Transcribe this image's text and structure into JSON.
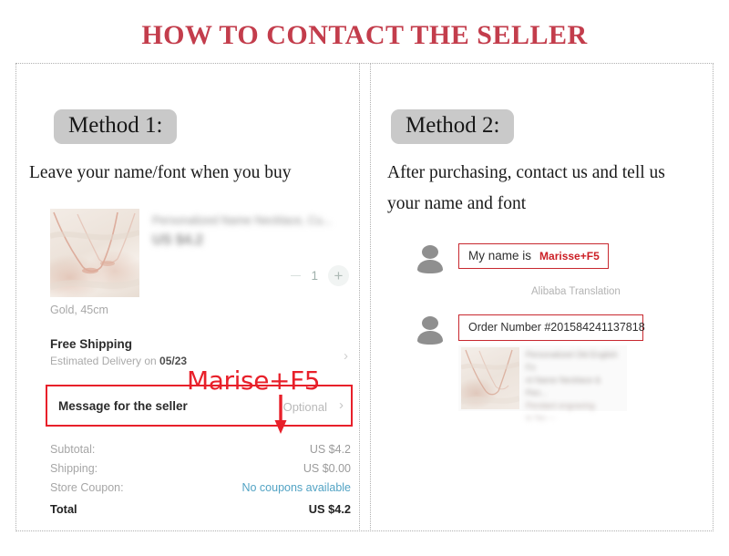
{
  "header": {
    "title": "HOW TO CONTACT THE SELLER",
    "title_color": "#c33d4c"
  },
  "accent": {
    "annotation_red": "#e8202a",
    "bubble_red": "#c8282f",
    "link_blue": "#52a3c4",
    "badge_grey": "#c9c9c9"
  },
  "methods": [
    {
      "badge": "Method 1:",
      "description": "Leave your name/font when you buy"
    },
    {
      "badge": "Method 2:",
      "description": "After purchasing, contact us and tell us your name and font"
    }
  ],
  "checkout": {
    "product": {
      "title_blurred": "Personalized Name Necklace, Cu...",
      "price_blurred": "US $4.2",
      "variant": "Gold, 45cm",
      "image_name": "necklace-product-photo"
    },
    "quantity": {
      "minus_label": "−",
      "value": "1",
      "plus_label": "+"
    },
    "shipping": {
      "title": "Free Shipping",
      "sub_prefix": "Estimated Delivery on ",
      "sub_date": "05/23",
      "chevron": "›"
    },
    "message_row": {
      "label": "Message for the seller",
      "value": "Optional",
      "chevron": "›"
    },
    "totals": [
      {
        "label": "Subtotal:",
        "value": "US $4.2"
      },
      {
        "label": "Shipping:",
        "value": "US $0.00"
      },
      {
        "label": "Store Coupon:",
        "value": "No coupons available"
      },
      {
        "label": "Total",
        "value": "US $4.2"
      }
    ],
    "annotation": {
      "text": "Marise+F5",
      "arrow_name": "red-down-arrow"
    }
  },
  "chat": {
    "messages": [
      {
        "plain": "My name is",
        "highlight": "Marisse+F5"
      },
      {
        "plain": "Order Number #201584241137818"
      }
    ],
    "translation_note": "Alibaba Translation",
    "order_card": {
      "line1_blurred": "Personalized Old English Fo",
      "line2_blurred": "nt Name Necklace & Pen...",
      "line3_blurred": "Pendant engraving",
      "line4_blurred": "to Yes ---",
      "image_name": "necklace-product-photo"
    }
  }
}
